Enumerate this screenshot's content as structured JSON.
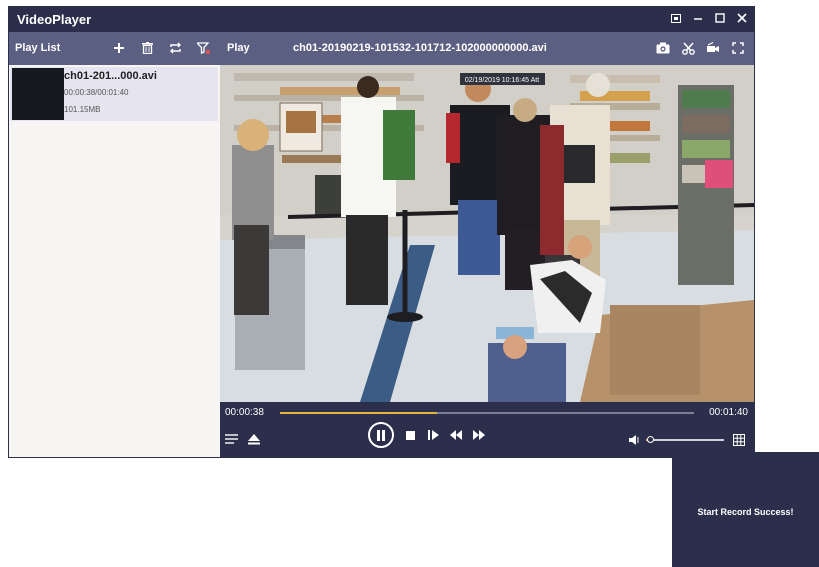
{
  "window": {
    "title": "VideoPlayer",
    "controls": [
      "restore-icon",
      "minimize-icon",
      "maximize-icon",
      "close-icon"
    ]
  },
  "playlist": {
    "title": "Play List",
    "tools": [
      "add-icon",
      "delete-icon",
      "loop-icon",
      "filter-icon"
    ],
    "items": [
      {
        "name": "ch01-201...000.avi",
        "time": "00:00:38/00:01:40",
        "size": "101.15MB"
      }
    ]
  },
  "player": {
    "play_label": "Play",
    "file_name": "ch01-20190219-101532-101712-102000000000.avi",
    "tools": [
      "snapshot-icon",
      "clip-icon",
      "record-icon",
      "fullscreen-icon"
    ],
    "video_timestamp": "02/19/2019 10:16:45 Att",
    "current_time": "00:00:38",
    "total_time": "00:01:40",
    "progress": 0.38,
    "volume": 0.05
  },
  "controls": {
    "left": [
      "playlist-toggle-icon",
      "eject-icon"
    ],
    "center": [
      "pause-icon",
      "stop-icon",
      "next-frame-icon",
      "rewind-icon",
      "fast-forward-icon"
    ],
    "right": [
      "volume-icon",
      "grid-layout-icon"
    ]
  },
  "toast": {
    "message": "Start Record Success!"
  },
  "colors": {
    "titlebar": "#2b2f4b",
    "subbar": "#5b5f82",
    "accent": "#e7b23c",
    "playlist_bg": "#f7f4f4",
    "selected_item": "#e6e4ee"
  }
}
